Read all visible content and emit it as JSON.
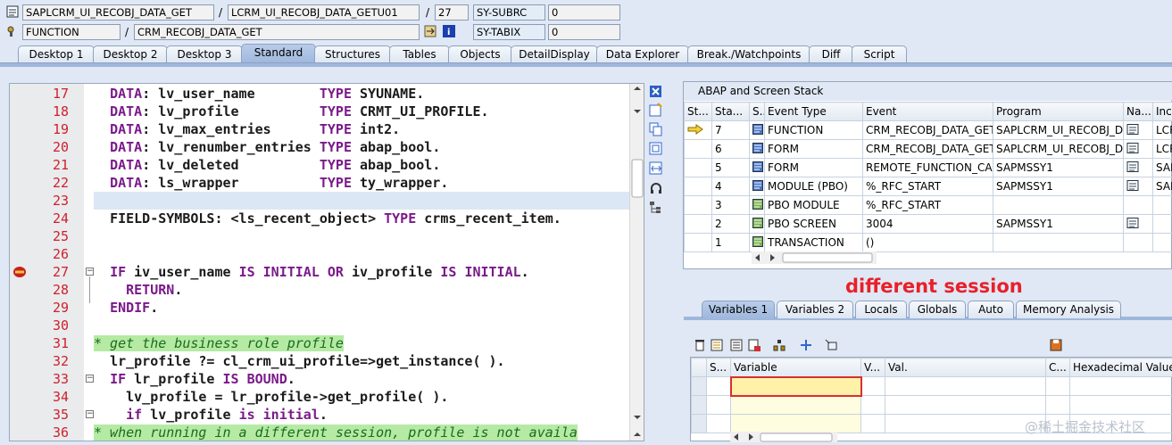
{
  "header": {
    "row1": {
      "program": "SAPLCRM_UI_RECOBJ_DATA_GET",
      "include": "LCRM_UI_RECOBJ_DATA_GETU01",
      "line": "27",
      "sysvar": "SY-SUBRC",
      "sysval": "0"
    },
    "row2": {
      "type": "FUNCTION",
      "name": "CRM_RECOBJ_DATA_GET",
      "sysvar": "SY-TABIX",
      "sysval": "0"
    },
    "sep": "/"
  },
  "tabs": [
    "Desktop 1",
    "Desktop 2",
    "Desktop 3",
    "Standard",
    "Structures",
    "Tables",
    "Objects",
    "DetailDisplay",
    "Data Explorer",
    "Break./Watchpoints",
    "Diff",
    "Script"
  ],
  "active_tab": "Standard",
  "editor": {
    "lines": [
      {
        "n": "17",
        "t": "  DATA: lv_user_name        TYPE SYUNAME."
      },
      {
        "n": "18",
        "t": "  DATA: lv_profile          TYPE CRMT_UI_PROFILE."
      },
      {
        "n": "19",
        "t": "  DATA: lv_max_entries      TYPE int2."
      },
      {
        "n": "20",
        "t": "  DATA: lv_renumber_entries TYPE abap_bool."
      },
      {
        "n": "21",
        "t": "  DATA: lv_deleted          TYPE abap_bool."
      },
      {
        "n": "22",
        "t": "  DATA: ls_wrapper          TYPE ty_wrapper."
      },
      {
        "n": "23",
        "t": ""
      },
      {
        "n": "24",
        "t": "  FIELD-SYMBOLS: <ls_recent_object> TYPE crms_recent_item."
      },
      {
        "n": "25",
        "t": ""
      },
      {
        "n": "26",
        "t": ""
      },
      {
        "n": "27",
        "t": "  IF iv_user_name IS INITIAL OR iv_profile IS INITIAL."
      },
      {
        "n": "28",
        "t": "    RETURN."
      },
      {
        "n": "29",
        "t": "  ENDIF."
      },
      {
        "n": "30",
        "t": ""
      },
      {
        "n": "31",
        "t": "* get the business role profile"
      },
      {
        "n": "32",
        "t": "  lr_profile ?= cl_crm_ui_profile=>get_instance( )."
      },
      {
        "n": "33",
        "t": "  IF lr_profile IS BOUND."
      },
      {
        "n": "34",
        "t": "    lv_profile = lr_profile->get_profile( )."
      },
      {
        "n": "35",
        "t": "    if lv_profile is initial."
      },
      {
        "n": "36",
        "t": "* when running in a different session, profile is not availa"
      }
    ]
  },
  "stack": {
    "title": "ABAP and Screen Stack",
    "columns": [
      "St...",
      "Sta...",
      "S...",
      "Event Type",
      "Event",
      "Program",
      "Na...",
      "Incl"
    ],
    "rows": [
      {
        "lvl": "7",
        "etype": "FUNCTION",
        "event": "CRM_RECOBJ_DATA_GET",
        "program": "SAPLCRM_UI_RECOBJ_D...",
        "incl": "LCR"
      },
      {
        "lvl": "6",
        "etype": "FORM",
        "event": "CRM_RECOBJ_DATA_GET",
        "program": "SAPLCRM_UI_RECOBJ_D...",
        "incl": "LCR"
      },
      {
        "lvl": "5",
        "etype": "FORM",
        "event": "REMOTE_FUNCTION_CA...",
        "program": "SAPMSSY1",
        "incl": "SAP"
      },
      {
        "lvl": "4",
        "etype": "MODULE (PBO)",
        "event": "%_RFC_START",
        "program": "SAPMSSY1",
        "incl": "SAP"
      },
      {
        "lvl": "3",
        "etype": "PBO MODULE",
        "event": "%_RFC_START",
        "program": "",
        "incl": ""
      },
      {
        "lvl": "2",
        "etype": "PBO SCREEN",
        "event": "3004",
        "program": "SAPMSSY1",
        "incl": ""
      },
      {
        "lvl": "1",
        "etype": "TRANSACTION",
        "event": "()",
        "program": "",
        "incl": ""
      }
    ]
  },
  "annotation": "different session",
  "bottom_tabs": [
    "Variables 1",
    "Variables 2",
    "Locals",
    "Globals",
    "Auto",
    "Memory Analysis"
  ],
  "variables": {
    "columns": [
      "S...",
      "Variable",
      "V...",
      "Val.",
      "C...",
      "Hexadecimal Value"
    ]
  },
  "watermark": "@稀土掘金技术社区",
  "colors": {
    "keyword": "#7a1a8a",
    "comment_bg": "#b4eaa4",
    "line_number": "#d0202b",
    "stack_text": "#1a3fae",
    "annotation": "#e8202a"
  }
}
